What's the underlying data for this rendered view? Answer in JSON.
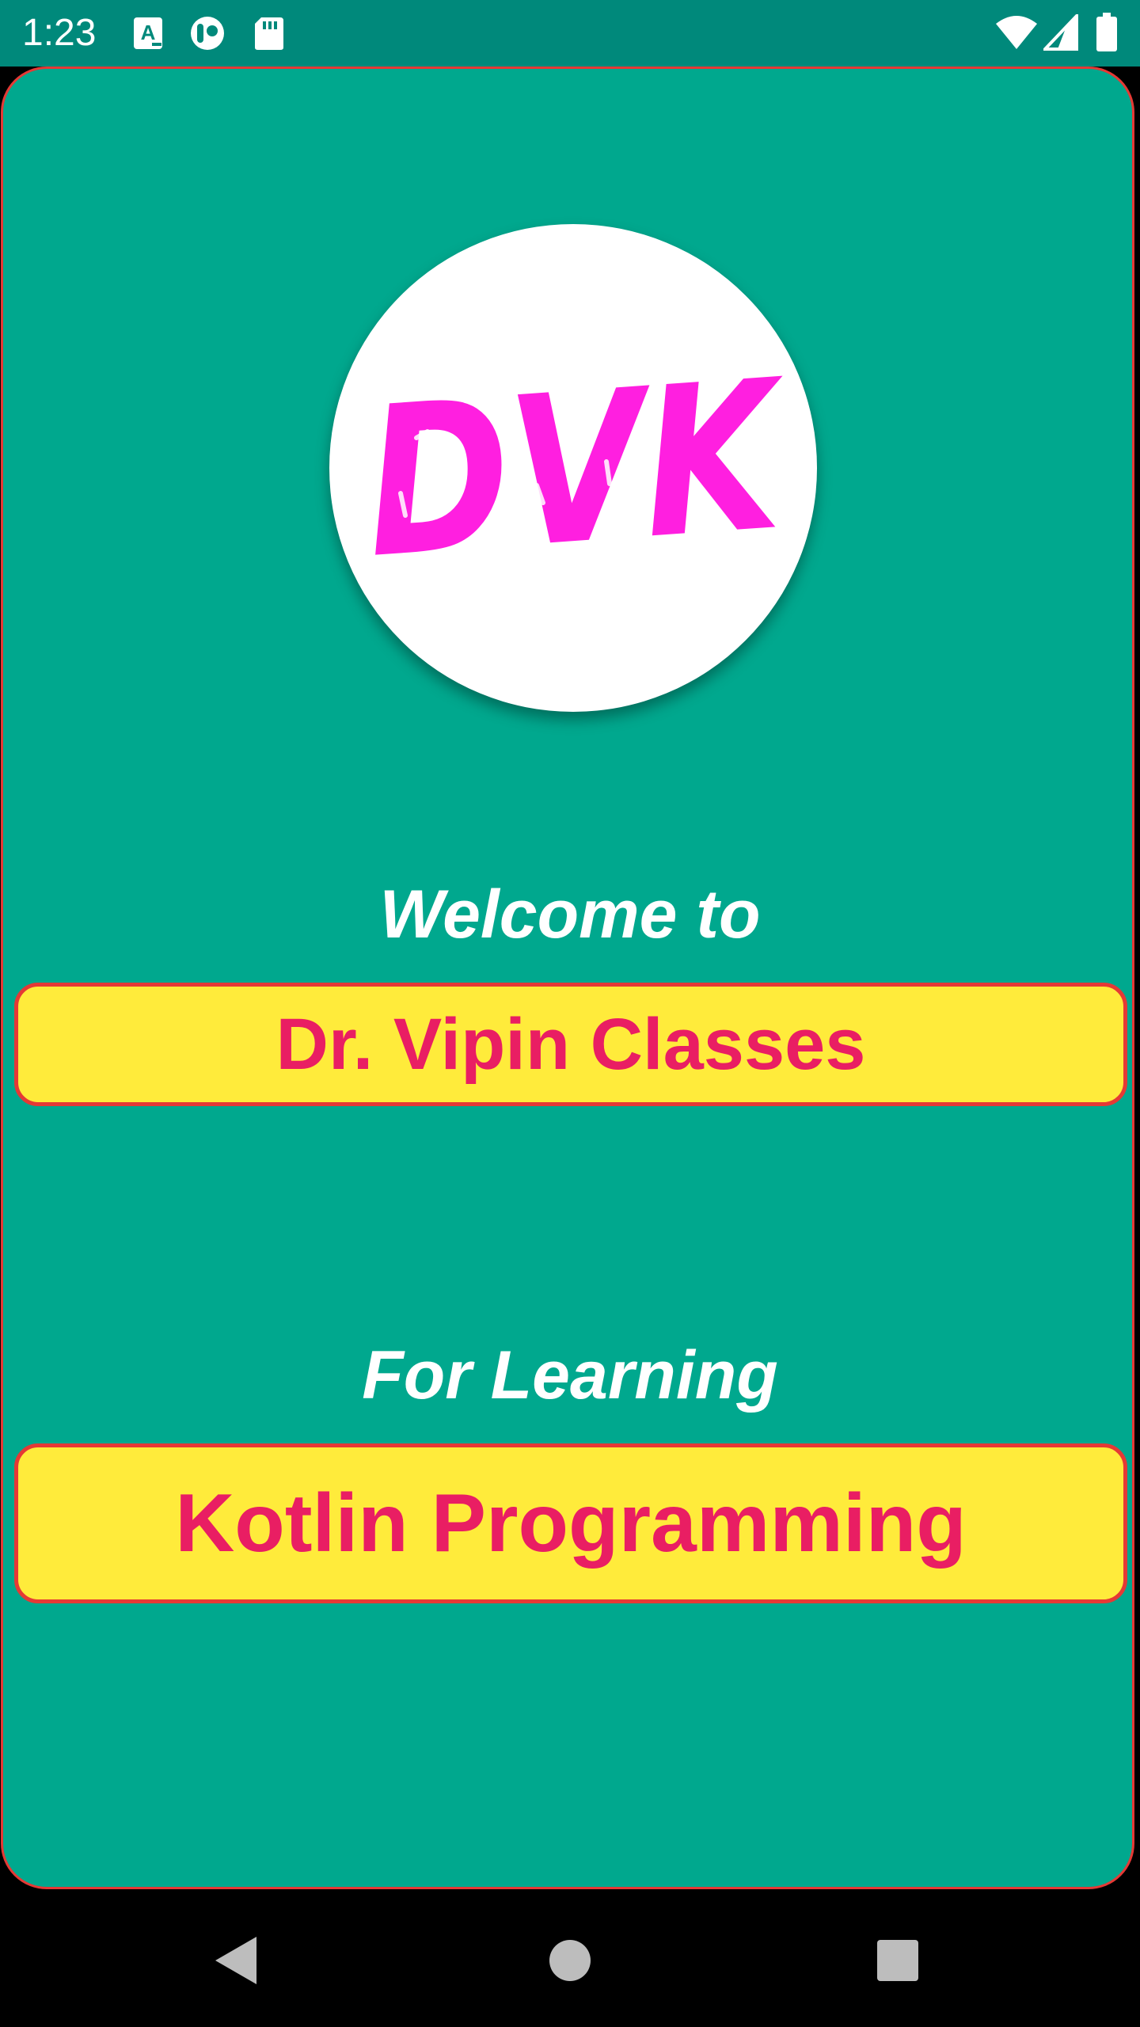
{
  "status_bar": {
    "time": "1:23",
    "background": "#00897B",
    "left_icons": [
      "font-a-icon",
      "toggle-icon",
      "sd-card-icon"
    ],
    "right_icons": [
      "wifi-icon",
      "signal-icon",
      "battery-icon"
    ]
  },
  "app": {
    "background": "#00A88E",
    "border_color": "#E53935",
    "logo": {
      "text": "DVK",
      "color": "#FF1FE0",
      "background": "#FFFFFF"
    },
    "welcome_text": "Welcome to",
    "institute_name": "Dr. Vipin Classes",
    "learning_text": "For Learning",
    "course_name": "Kotlin Programming",
    "pill_background": "#FFEB3B",
    "pill_text_color": "#E91E63"
  },
  "nav_bar": {
    "buttons": [
      "back-icon",
      "home-icon",
      "recents-icon"
    ]
  }
}
